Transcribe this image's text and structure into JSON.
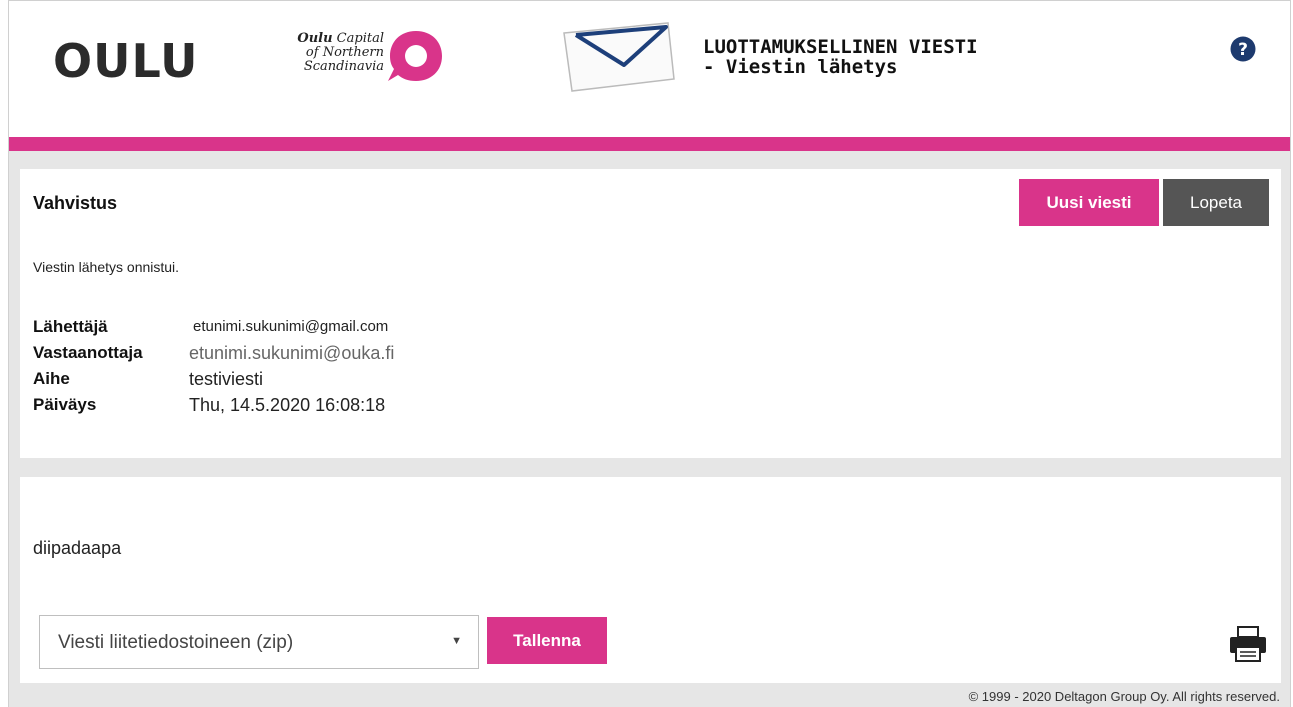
{
  "header": {
    "logo_text": "OULU",
    "capital_line1": "Oulu",
    "capital_line1_rest": " Capital",
    "capital_line2": "of Northern",
    "capital_line3": "Scandinavia",
    "title_line1": "LUOTTAMUKSELLINEN VIESTI",
    "title_line2": "- Viestin lähetys",
    "help_icon": "help-icon",
    "accent_color": "#d9348a"
  },
  "confirmation": {
    "heading": "Vahvistus",
    "new_message_label": "Uusi viesti",
    "quit_label": "Lopeta",
    "success_text": "Viestin lähetys onnistui.",
    "fields": [
      {
        "label": "Lähettäjä",
        "value": "etunimi.sukunimi@gmail.com"
      },
      {
        "label": "Vastaanottaja",
        "value": "etunimi.sukunimi@ouka.fi"
      },
      {
        "label": "Aihe",
        "value": "testiviesti"
      },
      {
        "label": "Päiväys",
        "value": "Thu, 14.5.2020 16:08:18"
      }
    ]
  },
  "message": {
    "body": "diipadaapa",
    "download_select_value": "Viesti liitetiedostoineen (zip)",
    "save_label": "Tallenna",
    "print_icon": "printer-icon"
  },
  "footer": {
    "copyright": "© 1999 - 2020 Deltagon Group Oy. All rights reserved."
  }
}
